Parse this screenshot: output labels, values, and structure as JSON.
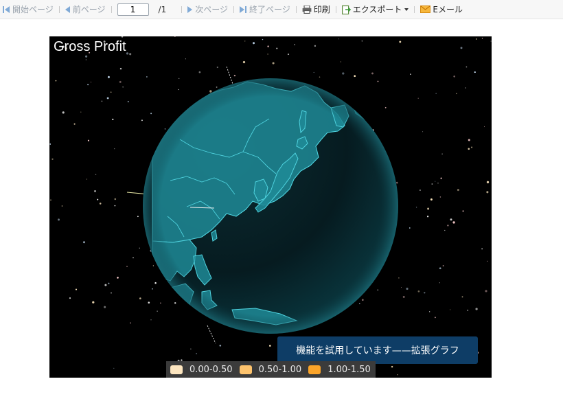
{
  "toolbar": {
    "first_page": "開始ページ",
    "prev_page": "前ページ",
    "page_value": "1",
    "page_total": "/1",
    "next_page": "次ページ",
    "last_page": "終了ページ",
    "print": "印刷",
    "export": "エクスポート",
    "email": "Eメール"
  },
  "chart": {
    "title": "Gross Profit",
    "trial_banner": "機能を試用しています——拡張グラフ",
    "legend": [
      {
        "label": "0.00-0.50",
        "color": "#fde6c0"
      },
      {
        "label": "0.50-1.00",
        "color": "#fdc36d"
      },
      {
        "label": "1.00-1.50",
        "color": "#fba429"
      }
    ],
    "globe_color": "#1f8a96",
    "border_color": "#4fd3df"
  }
}
